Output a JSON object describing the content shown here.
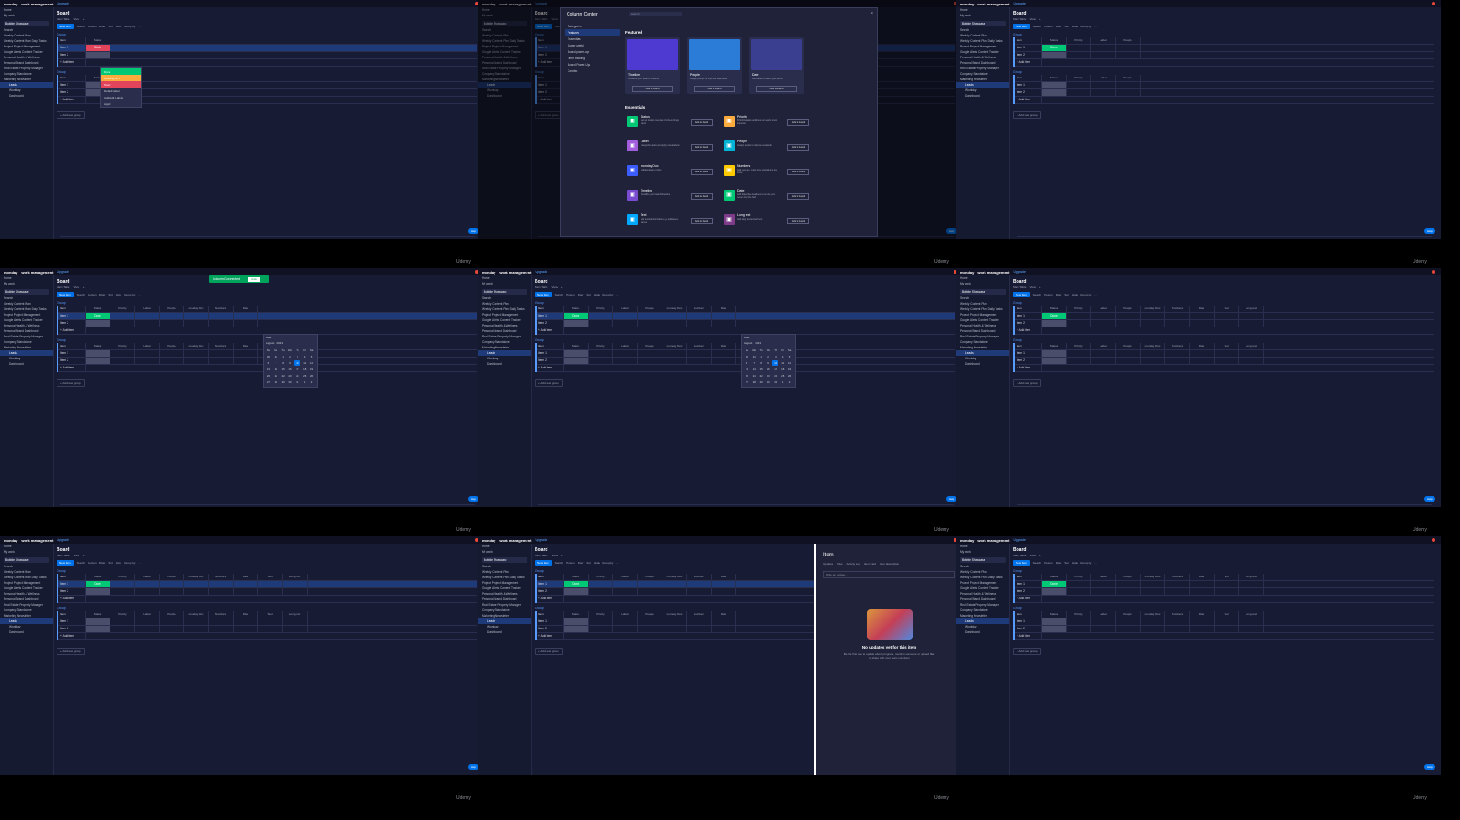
{
  "app": {
    "brand": "monday",
    "product": "work management",
    "upgrade": "Upgrade"
  },
  "caption": "Udemy",
  "sidebar": {
    "items": [
      "Home",
      "My work"
    ],
    "workspace": "Bubble Showcase",
    "search": "Search",
    "boards": [
      "Weekly Content Plan",
      "Weekly Content Plan Daily Tasks",
      "Project Project Management",
      "Google Alerts Content Tracker",
      "Personal Health & Wellness",
      "Personal Brand Dashboard",
      "Real Estate Property Manager",
      "Company Standalone",
      "Marketing Newsletter"
    ],
    "subitems": [
      "Leads",
      "Workday",
      "Dashboard"
    ]
  },
  "board": {
    "title": "Board",
    "views": [
      "Main Table",
      "View",
      "+"
    ],
    "new_item": "New Item",
    "tools": [
      "Search",
      "Person",
      "Filter",
      "Sort",
      "Hide",
      "Group by",
      "..."
    ],
    "group1": "Group",
    "group2": "Group",
    "headers_a": [
      "Item",
      "Status"
    ],
    "headers_b": [
      "Item",
      "Status",
      "Priority",
      "Label",
      "People"
    ],
    "headers_c": [
      "Item",
      "Status",
      "Priority",
      "Label",
      "People",
      "monday Doc",
      "Numbers",
      "Date"
    ],
    "headers_d": [
      "Item",
      "Status",
      "Priority",
      "Label",
      "People",
      "monday Doc",
      "Numbers",
      "Date",
      "Text",
      "Long text"
    ],
    "rows": [
      "Item 1",
      "Item 2"
    ],
    "add_item": "+ Add item",
    "status_stuck": "Stuck",
    "status_done": "Done",
    "add_group": "+ Add new group",
    "help": "Help"
  },
  "status_menu": [
    "Done",
    "Working on it",
    "Stuck",
    "Default label",
    "Add/Edit Labels",
    "Apply"
  ],
  "column_center": {
    "title": "Column Center",
    "search": "Search",
    "categories": [
      "Categories",
      "Featured",
      "Essentials",
      "Super useful",
      "Board power-ups",
      "Time tracking",
      "Board Power-Ups",
      "Combo"
    ],
    "featured_title": "Featured",
    "featured": [
      {
        "name": "Timeline",
        "desc": "Visualize your team's timeline",
        "btn": "Add to board"
      },
      {
        "name": "People",
        "desc": "Assign people to improve teamwork",
        "btn": "Add to board"
      },
      {
        "name": "Date",
        "desc": "Add dates to track your items",
        "btn": "Add to board"
      }
    ],
    "essentials_title": "Essentials",
    "essentials": [
      {
        "name": "Status",
        "desc": "Get an instant overview of where things stand",
        "btn": "Add to board",
        "color": "#00c875"
      },
      {
        "name": "Priority",
        "desc": "Prioritize tasks and focus on what's most important",
        "btn": "Add to board",
        "color": "#fdab3d"
      },
      {
        "name": "Label",
        "desc": "Categorize tasks and apply visual labels",
        "btn": "Add to board",
        "color": "#a25ddc"
      },
      {
        "name": "People",
        "desc": "Assign people to improve teamwork",
        "btn": "Add to board",
        "color": "#00b2d4"
      },
      {
        "name": "monday Doc",
        "desc": "Collaborate on a Doc",
        "btn": "Add to board",
        "color": "#3d5cfd"
      },
      {
        "name": "Numbers",
        "desc": "Add revenue, costs, time estimations and more",
        "btn": "Add to board",
        "color": "#ffcb00"
      },
      {
        "name": "Timeline",
        "desc": "Visualize your board's timeline",
        "btn": "Add to board",
        "color": "#784bd1"
      },
      {
        "name": "Date",
        "desc": "Add dates like deadlines to ensure you never drop the ball",
        "btn": "Add to board",
        "color": "#00c875"
      },
      {
        "name": "Text",
        "desc": "Add textual information e.g. addresses, names",
        "btn": "Add to board",
        "color": "#00a9ff"
      },
      {
        "name": "Long text",
        "desc": "Add large amounts of text",
        "btn": "Add to board",
        "color": "#7e3b8a"
      }
    ]
  },
  "toast": {
    "text": "Column Connected",
    "undo": "Undo",
    "close": "×"
  },
  "datepicker": {
    "title": "Date",
    "month": "August",
    "year": "2023",
    "days": [
      "Su",
      "Mo",
      "Tu",
      "We",
      "Th",
      "Fr",
      "Sa"
    ],
    "dates": [
      "30",
      "31",
      "1",
      "2",
      "3",
      "4",
      "5",
      "6",
      "7",
      "8",
      "9",
      "10",
      "11",
      "12",
      "13",
      "14",
      "15",
      "16",
      "17",
      "18",
      "19",
      "20",
      "21",
      "22",
      "23",
      "24",
      "25",
      "26",
      "27",
      "28",
      "29",
      "30",
      "31",
      "1",
      "2"
    ],
    "today": "10"
  },
  "item_panel": {
    "title": "Item",
    "tabs": [
      "Updates",
      "Files",
      "Activity Log",
      "Item Card",
      "Item description"
    ],
    "update_placeholder": "Write an update...",
    "empty_title": "No updates yet for this item",
    "empty_desc": "Be the first one to update about progress, mention someone or upload files to share with your team members"
  },
  "colors": {
    "bg": "#181b34",
    "accent": "#0073ea",
    "done": "#00c875",
    "stuck": "#e2445c"
  }
}
